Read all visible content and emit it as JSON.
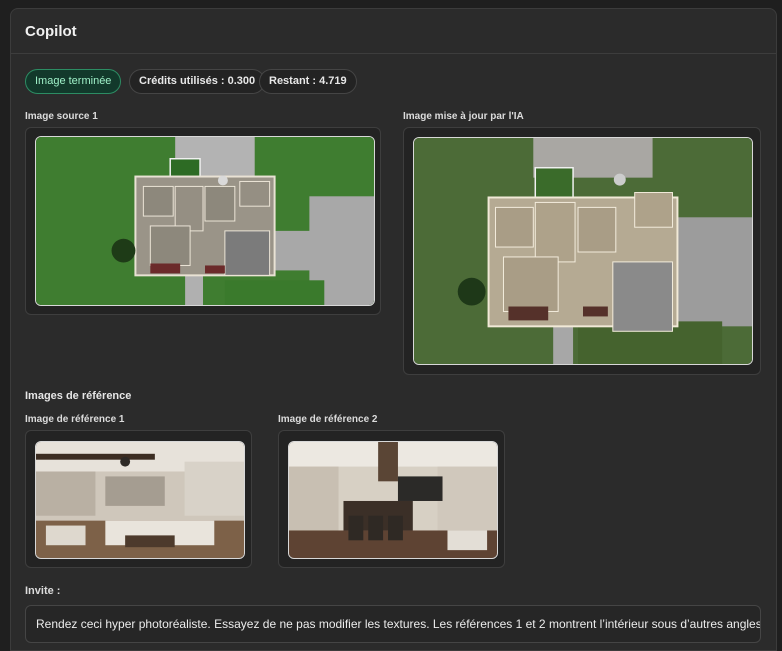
{
  "panel": {
    "title": "Copilot"
  },
  "status": {
    "badge_label": "Image terminée",
    "credits_used": "Crédits utilisés : 0.300",
    "remaining": "Restant : 4.719"
  },
  "source": {
    "label": "Image source 1"
  },
  "updated": {
    "label": "Image mise à jour par l'IA"
  },
  "references": {
    "section_title": "Images de référence",
    "items": [
      {
        "label": "Image de référence 1"
      },
      {
        "label": "Image de référence 2"
      }
    ]
  },
  "prompt": {
    "label": "Invite :",
    "value": "Rendez ceci hyper photoréaliste. Essayez de ne pas modifier les textures. Les références 1 et 2 montrent l’intérieur sous d’autres angles."
  },
  "colors": {
    "status_green": "#2c8c63",
    "panel_bg": "#2b2b2b",
    "page_bg": "#1f1f1f"
  }
}
